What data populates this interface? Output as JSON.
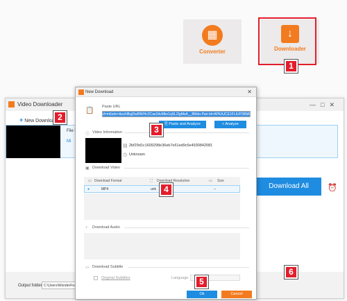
{
  "launcher": {
    "converter_label": "Converter",
    "converter_icon": "film-icon",
    "downloader_label": "Downloader",
    "downloader_icon": "download-icon"
  },
  "badges": [
    "1",
    "2",
    "3",
    "4",
    "5",
    "6"
  ],
  "main_window": {
    "title": "Video Downloader",
    "new_download_label": "New Download",
    "file_name_label": "File N",
    "mini_label": "Mi",
    "output_folder_label": "Output folder:",
    "output_folder_value": "C:\\Users\\WonderFox\\Do",
    "download_all_label": "Download All",
    "accent_color": "#1e8ce0",
    "brand_color": "#f27b1f"
  },
  "dialog": {
    "title": "New Download",
    "paste_url_label": "Paste URL",
    "url_value": "d=m6sdo=&ezNfkgDwf0WHc2Cae2dvMkn1qSL2IgMsA__8Mdo-Pair-Id=APKAJCE1FLIUP3RMQTKA",
    "paste_analyze_label": "Paste and Analyze",
    "analyze_label": "Analyze",
    "video_info_label": "Video Information",
    "video_id": "2bf29d1c1609298e36eb7e61ed9c5e4930842081",
    "duration": "Unknown",
    "download_video_label": "Download Video",
    "columns": {
      "format": "Download Format",
      "resolution": "Download Resolution",
      "size": "Size"
    },
    "rows": [
      {
        "format": "MP4",
        "resolution": "unk",
        "size": "--"
      }
    ],
    "download_audio_label": "Download Audio",
    "download_subtitle_label": "Download Subtitle",
    "original_subtitles_label": "Original Subtitles",
    "language_label": "Language",
    "ok_label": "Ok",
    "cancel_label": "Cancel"
  }
}
